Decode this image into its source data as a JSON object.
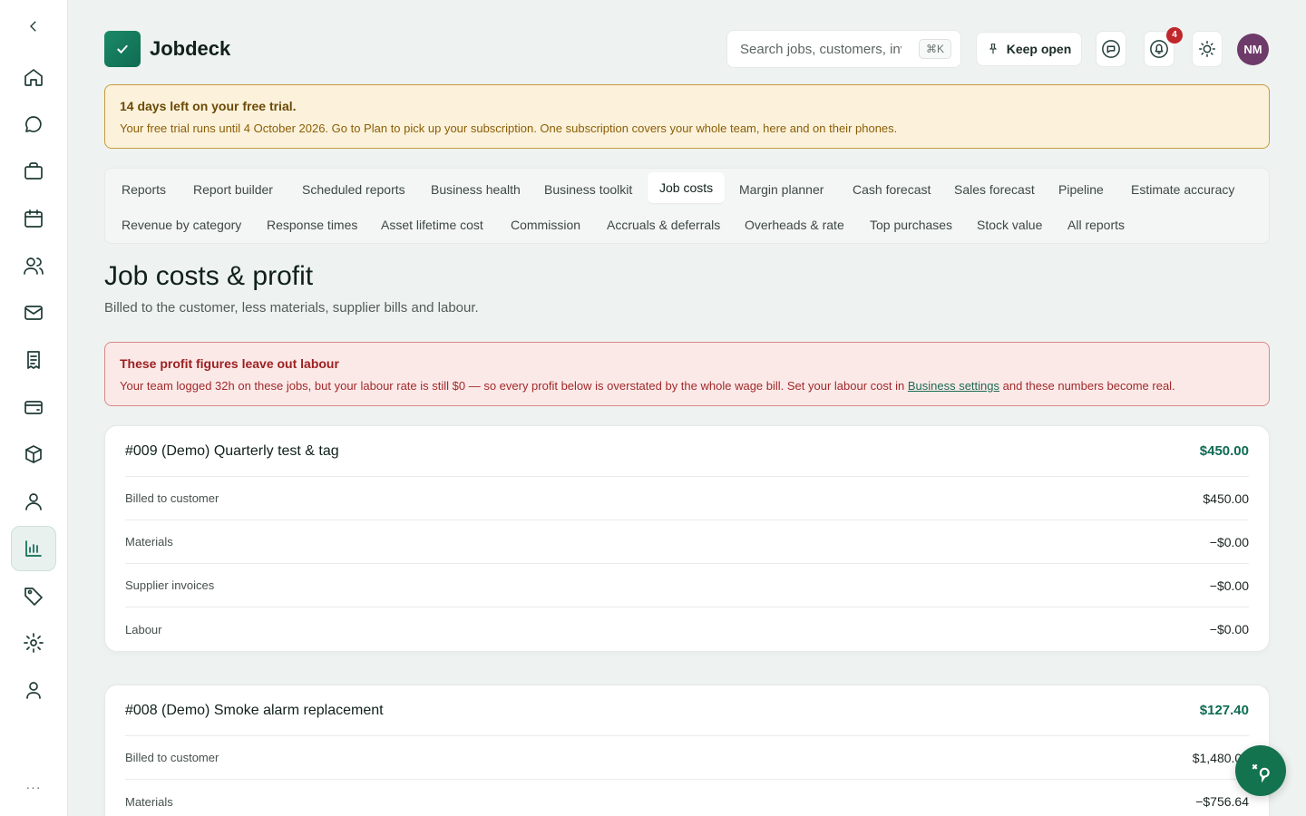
{
  "app": {
    "name": "Jobdeck"
  },
  "header": {
    "search_placeholder": "Search jobs, customers, inv",
    "search_shortcut": "⌘K",
    "keep_open_label": "Keep open",
    "notification_count": "4",
    "avatar_initials": "NM"
  },
  "sidebar": {
    "items": [
      {
        "icon": "home-icon"
      },
      {
        "icon": "chat-icon"
      },
      {
        "icon": "briefcase-icon"
      },
      {
        "icon": "calendar-icon"
      },
      {
        "icon": "users-icon"
      },
      {
        "icon": "mail-icon"
      },
      {
        "icon": "receipt-icon"
      },
      {
        "icon": "wallet-icon"
      },
      {
        "icon": "box-icon"
      },
      {
        "icon": "person-icon"
      },
      {
        "icon": "bar-chart-icon",
        "active": true
      },
      {
        "icon": "tag-icon"
      },
      {
        "icon": "gear-icon"
      },
      {
        "icon": "account-icon"
      }
    ],
    "more": "···"
  },
  "trial": {
    "title": "14 days left on your free trial.",
    "body": "Your free trial runs until 4 October 2026. Go to Plan to pick up your subscription. One subscription covers your whole team, here and on their phones."
  },
  "tabs": [
    "Reports",
    "Report builder",
    "Scheduled reports",
    "Business health",
    "Business toolkit",
    "Job costs",
    "Margin planner",
    "Cash forecast",
    "Sales forecast",
    "Pipeline",
    "Estimate accuracy",
    "Revenue by category",
    "Response times",
    "Asset lifetime cost",
    "Commission",
    "Accruals & deferrals",
    "Overheads & rate",
    "Top purchases",
    "Stock value",
    "All reports"
  ],
  "active_tab": "Job costs",
  "page": {
    "title": "Job costs & profit",
    "subtitle": "Billed to the customer, less materials, supplier bills and labour."
  },
  "warning": {
    "title": "These profit figures leave out labour",
    "body_before": "Your team logged 32h on these jobs, but your labour rate is still $0 — so every profit below is overstated by the whole wage bill. Set your labour cost in ",
    "link": "Business settings",
    "body_after": " and these numbers become real."
  },
  "jobs": [
    {
      "name": "#009 (Demo) Quarterly test & tag",
      "profit": "$450.00",
      "rows": [
        {
          "label": "Billed to customer",
          "value": "$450.00"
        },
        {
          "label": "Materials",
          "value": "−$0.00"
        },
        {
          "label": "Supplier invoices",
          "value": "−$0.00"
        },
        {
          "label": "Labour",
          "value": "−$0.00"
        }
      ]
    },
    {
      "name": "#008 (Demo) Smoke alarm replacement",
      "profit": "$127.40",
      "rows": [
        {
          "label": "Billed to customer",
          "value": "$1,480.00"
        },
        {
          "label": "Materials",
          "value": "−$756.64"
        }
      ]
    }
  ]
}
